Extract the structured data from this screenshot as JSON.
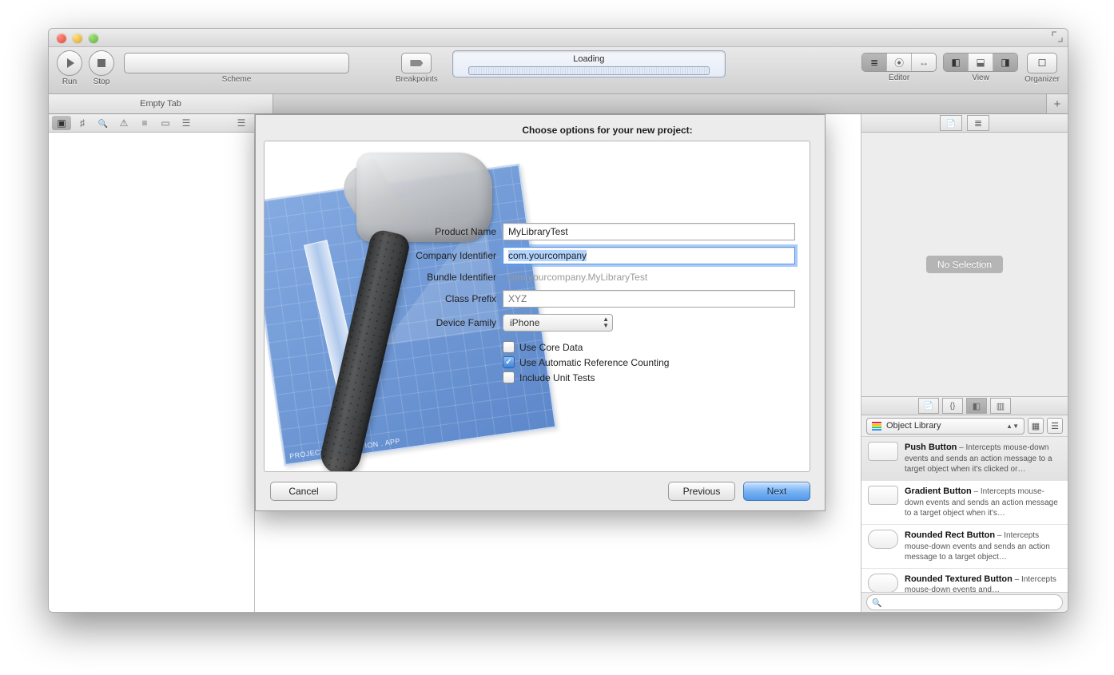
{
  "toolbar": {
    "run_label": "Run",
    "stop_label": "Stop",
    "scheme_label": "Scheme",
    "breakpoints_label": "Breakpoints",
    "activity_text": "Loading",
    "editor_label": "Editor",
    "view_label": "View",
    "organizer_label": "Organizer"
  },
  "tabbar": {
    "tab_title": "Empty Tab",
    "add_tab": "+"
  },
  "navigator_icons": [
    "folder",
    "symbol",
    "search",
    "issue",
    "test",
    "debug",
    "breakpoint",
    "log"
  ],
  "utilities": {
    "no_selection": "No Selection",
    "library_selector": "Object Library",
    "items": [
      {
        "title": "Push Button",
        "desc": " – Intercepts mouse-down events and sends an action message to a target object when it's clicked or…",
        "shape": "rect",
        "selected": true
      },
      {
        "title": "Gradient Button",
        "desc": " – Intercepts mouse-down events and sends an action message to a target object when it's…",
        "shape": "rect"
      },
      {
        "title": "Rounded Rect Button",
        "desc": " – Intercepts mouse-down events and sends an action message to a target object…",
        "shape": "round"
      },
      {
        "title": "Rounded Textured Button",
        "desc": " – Intercepts mouse-down events and…",
        "shape": "round"
      }
    ]
  },
  "sheet": {
    "title": "Choose options for your new project:",
    "blueprint_label": "PROJECT: APPLICATION . APP",
    "fields": {
      "product_name_label": "Product Name",
      "product_name_value": "MyLibraryTest",
      "company_id_label": "Company Identifier",
      "company_id_value": "com.yourcompany",
      "bundle_id_label": "Bundle Identifier",
      "bundle_id_value": "com.yourcompany.MyLibraryTest",
      "class_prefix_label": "Class Prefix",
      "class_prefix_placeholder": "XYZ",
      "device_family_label": "Device Family",
      "device_family_value": "iPhone",
      "use_core_data_label": "Use Core Data",
      "use_core_data_checked": false,
      "use_arc_label": "Use Automatic Reference Counting",
      "use_arc_checked": true,
      "include_tests_label": "Include Unit Tests",
      "include_tests_checked": false
    },
    "buttons": {
      "cancel": "Cancel",
      "previous": "Previous",
      "next": "Next"
    }
  }
}
